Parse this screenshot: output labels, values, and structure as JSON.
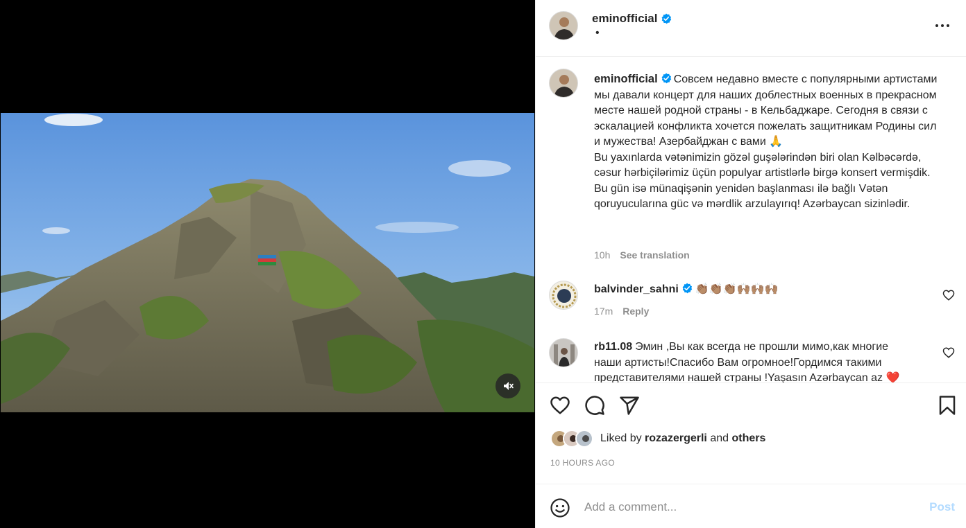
{
  "post": {
    "username": "eminofficial",
    "location_dot": "•",
    "more_label": "More options"
  },
  "caption": {
    "username": "eminofficial",
    "text_ru": "Совсем недавно вместе с популярными артистами мы давали концерт для наших доблестных военных в прекрасном месте нашей родной страны - в Кельбаджаре. Сегодня в связи с эскалацией конфликта хочется пожелать защитникам Родины сил и мужества! Азербайджан с вами 🙏",
    "text_az": "Bu yaxınlarda vətənimizin gözəl guşələrindən biri olan Kəlbəcərdə, cəsur hərbiçilərimiz üçün populyar artistlərlə birgə konsert vermişdik. Bu gün isə münaqişənin yenidən başlanması ilə bağlı Vətən qoruyucularına güc və mərdlik arzulayırıq! Azərbaycan sizinlədir.",
    "time": "10h",
    "see_translation": "See translation"
  },
  "comments": [
    {
      "username": "balvinder_sahni",
      "text": "👏🏽👏🏽👏🏽🙌🏽🙌🏽🙌🏽",
      "time": "17m",
      "reply": "Reply"
    },
    {
      "username": "rb11.08",
      "text": "Эмин ,Вы как всегда не прошли мимо,как многие наши артисты!Спасибо Вам огромное!Гордимся такими представителями нашей страны !Yaşasın Azərbaycan az ❤️"
    }
  ],
  "likes": {
    "prefix": "Liked by",
    "user": "rozazergerli",
    "and": "and",
    "others": "others"
  },
  "timestamp": "10 HOURS AGO",
  "add_comment": {
    "placeholder": "Add a comment...",
    "post_label": "Post"
  },
  "colors": {
    "verified": "#0095f6",
    "post_disabled": "#b3dbff",
    "secondary_text": "#8e8e8e"
  },
  "icons": [
    "verified-badge-icon",
    "more-options-icon",
    "mute-icon",
    "heart-icon",
    "comment-icon",
    "share-icon",
    "bookmark-icon",
    "emoji-icon"
  ]
}
